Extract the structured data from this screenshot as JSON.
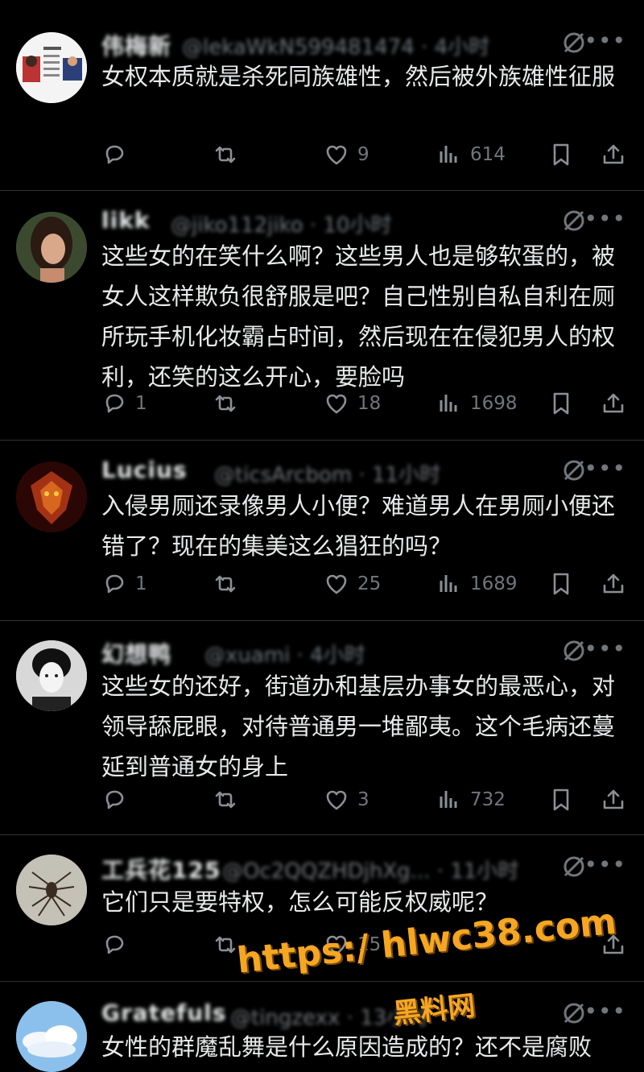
{
  "posts": [
    {
      "name": "伟梅新",
      "handle": "@lekaWkN599481474 · 4小时",
      "text": "女权本质就是杀死同族雄性，然后被外族雄性征服",
      "reply": "",
      "retweet": "",
      "like": "9",
      "views": "614"
    },
    {
      "name": "likk",
      "handle": "@jiko112jiko · 10小时",
      "text": "这些女的在笑什么啊？这些男人也是够软蛋的，被女人这样欺负很舒服是吧？自己性别自私自利在厕所玩手机化妆霸占时间，然后现在在侵犯男人的权利，还笑的这么开心，要脸吗",
      "reply": "1",
      "retweet": "",
      "like": "18",
      "views": "1698"
    },
    {
      "name": "Lucius",
      "handle": "@ticsArcbom · 11小时",
      "text": "入侵男厕还录像男人小便？难道男人在男厕小便还错了？现在的集美这么猖狂的吗？",
      "reply": "1",
      "retweet": "",
      "like": "25",
      "views": "1689"
    },
    {
      "name": "幻想鸭",
      "handle": "@xuami · 4小时",
      "text": "这些女的还好，街道办和基层办事女的最恶心，对领导舔屁眼，对待普通男一堆鄙夷。这个毛病还蔓延到普通女的身上",
      "reply": "",
      "retweet": "",
      "like": "3",
      "views": "732"
    },
    {
      "name": "工兵花125",
      "handle": "@Oc2QQZHDjhXg... · 11小时",
      "text": "它们只是要特权，怎么可能反权威呢？",
      "reply": "",
      "retweet": "",
      "like": "15",
      "views": ""
    },
    {
      "name": "Gratefuls",
      "handle": "@tingzexx · 13小时",
      "text": "女性的群魔乱舞是什么原因造成的？还不是腐败",
      "reply": "",
      "retweet": "",
      "like": "",
      "views": ""
    }
  ],
  "watermark": {
    "url": "https:/ hlwc38.com",
    "label": "黑料网"
  },
  "icons": {
    "reply": "reply-icon",
    "retweet": "retweet-icon",
    "like": "heart-icon",
    "views": "views-icon",
    "bookmark": "bookmark-icon",
    "share": "share-icon",
    "grok": "grok-icon",
    "more": "more-icon"
  },
  "colors": {
    "background": "#000000",
    "text": "#e7e9ea",
    "secondary": "#71767b",
    "divider": "#2f3336",
    "watermark": "#f5a623"
  }
}
